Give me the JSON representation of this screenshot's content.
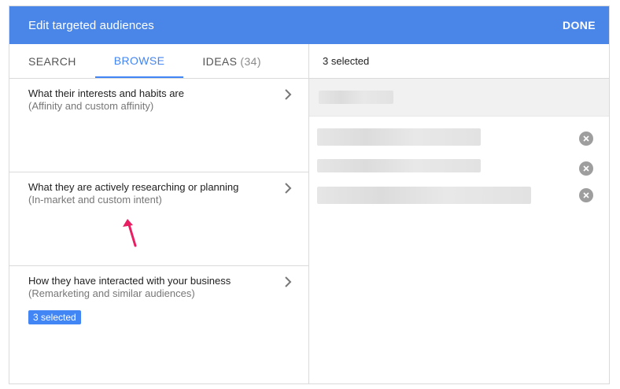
{
  "header": {
    "title": "Edit targeted audiences",
    "done_label": "DONE"
  },
  "tabs": [
    {
      "label": "SEARCH",
      "count": "",
      "active": false
    },
    {
      "label": "BROWSE",
      "count": "",
      "active": true
    },
    {
      "label": "IDEAS",
      "count": "(34)",
      "active": false
    }
  ],
  "categories": [
    {
      "title": "What their interests and habits are",
      "subtitle": "(Affinity and custom affinity)",
      "badge": ""
    },
    {
      "title": "What they are actively researching or planning",
      "subtitle": "(In-market and custom intent)",
      "badge": ""
    },
    {
      "title": "How they have interacted with your business",
      "subtitle": "(Remarketing and similar audiences)",
      "badge": "3 selected"
    }
  ],
  "selection": {
    "summary": "3 selected",
    "removed_icon": "remove-circle-icon"
  },
  "colors": {
    "header_bg": "#4a86e8",
    "accent": "#4285f4",
    "annotation_arrow": "#e91e63"
  }
}
